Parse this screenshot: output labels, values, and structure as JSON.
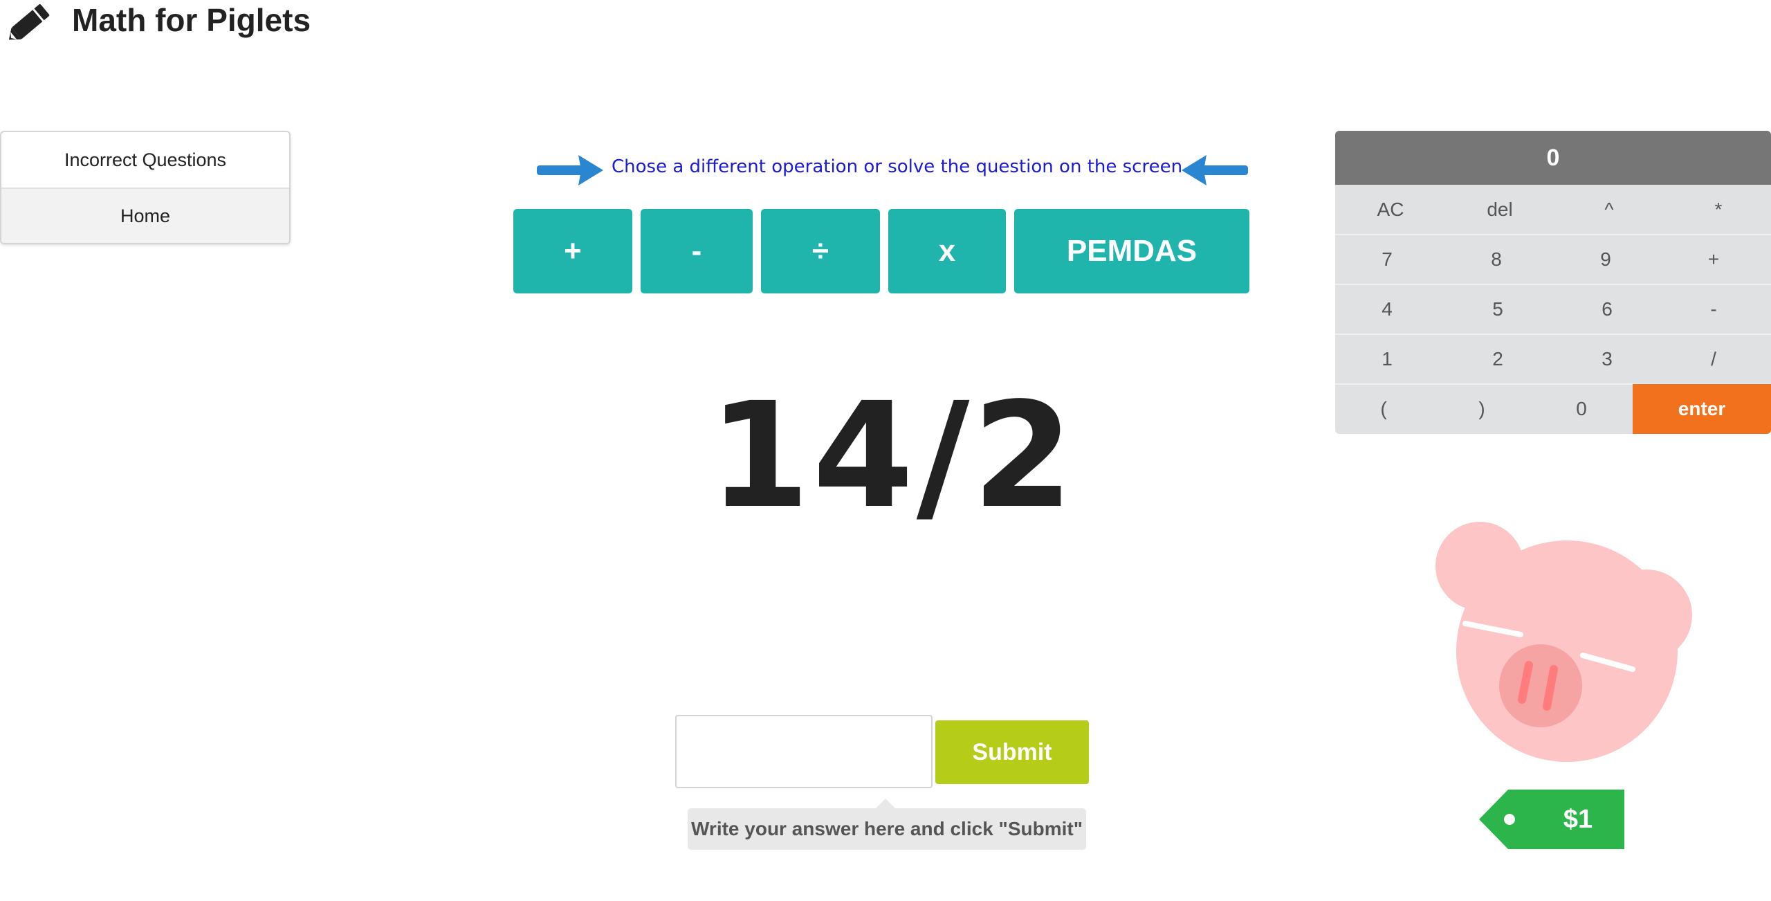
{
  "header": {
    "title": "Math for Piglets",
    "icon": "pencil-icon"
  },
  "menu": {
    "items": [
      {
        "label": "Incorrect Questions",
        "active": false
      },
      {
        "label": "Home",
        "active": true
      }
    ]
  },
  "instruction": {
    "text": "Chose a different operation or solve the question on the screen",
    "color": "#1a1ad8",
    "arrow_color": "#2a86d1"
  },
  "operations": {
    "color": "#1fb5ad",
    "buttons": [
      {
        "label": "+"
      },
      {
        "label": "-"
      },
      {
        "label": "÷"
      },
      {
        "label": "x"
      },
      {
        "label": "PEMDAS"
      }
    ]
  },
  "question": {
    "text": "14/2"
  },
  "answer": {
    "value": "",
    "submit_label": "Submit",
    "submit_color": "#b5cc18",
    "hint": "Write your answer here and click \"Submit\""
  },
  "calculator": {
    "display": "0",
    "rows": [
      [
        "AC",
        "del",
        "^",
        "*"
      ],
      [
        "7",
        "8",
        "9",
        "+"
      ],
      [
        "4",
        "5",
        "6",
        "-"
      ],
      [
        "1",
        "2",
        "3",
        "/"
      ],
      [
        "(",
        ")",
        "0",
        "enter"
      ]
    ],
    "enter_color": "#f2711c"
  },
  "pig": {
    "color": "#fdc5c5",
    "snout_color": "#f6a3a3",
    "nostril_color": "#ff7c7c"
  },
  "price_tag": {
    "amount": "$1",
    "color": "#2cb54a"
  }
}
